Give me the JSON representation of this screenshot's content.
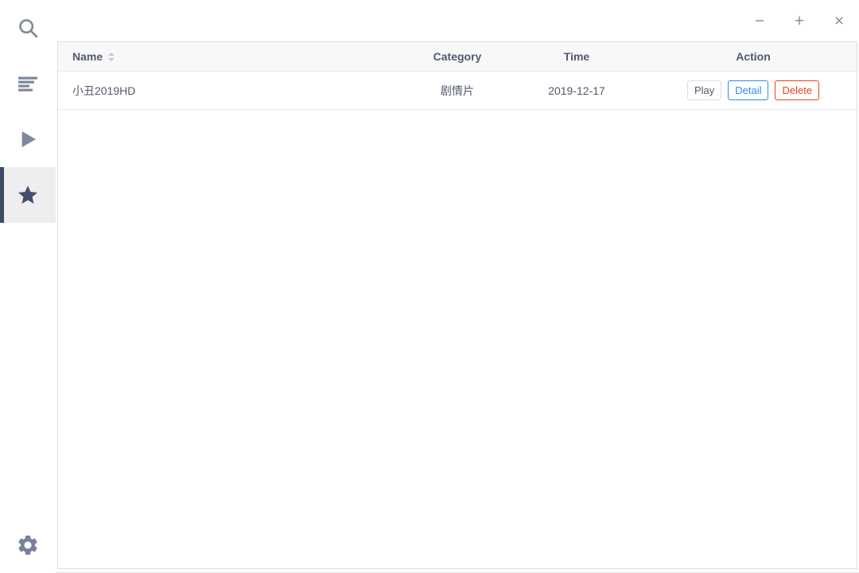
{
  "window": {
    "controls": {
      "minimize_glyph": "−",
      "maximize_glyph": "+",
      "close_glyph": "×"
    }
  },
  "sidebar": {
    "items": [
      {
        "id": "search",
        "icon": "search-icon",
        "active": false
      },
      {
        "id": "playlist",
        "icon": "list-icon",
        "active": false
      },
      {
        "id": "player",
        "icon": "play-icon",
        "active": false
      },
      {
        "id": "favorites",
        "icon": "star-icon",
        "active": true
      },
      {
        "id": "settings",
        "icon": "gear-icon",
        "active": false
      }
    ]
  },
  "table": {
    "columns": [
      {
        "label": "Name",
        "sortable": true,
        "align": "left"
      },
      {
        "label": "Category",
        "align": "center"
      },
      {
        "label": "Time",
        "align": "center"
      },
      {
        "label": "Action",
        "align": "center"
      }
    ],
    "rows": [
      {
        "name": "小丑2019HD",
        "category": "剧情片",
        "time": "2019-12-17",
        "actions": [
          {
            "label": "Play",
            "type": "default"
          },
          {
            "label": "Detail",
            "type": "info"
          },
          {
            "label": "Delete",
            "type": "error"
          }
        ]
      }
    ]
  },
  "colors": {
    "info": "#2d8cf0",
    "error": "#ed4014",
    "text": "#515a6e",
    "icon": "#7e899c",
    "icon_active": "#44506b",
    "active_bar": "#3e4b66",
    "header_bg": "#f8f8f9",
    "border": "#e8eaec"
  }
}
